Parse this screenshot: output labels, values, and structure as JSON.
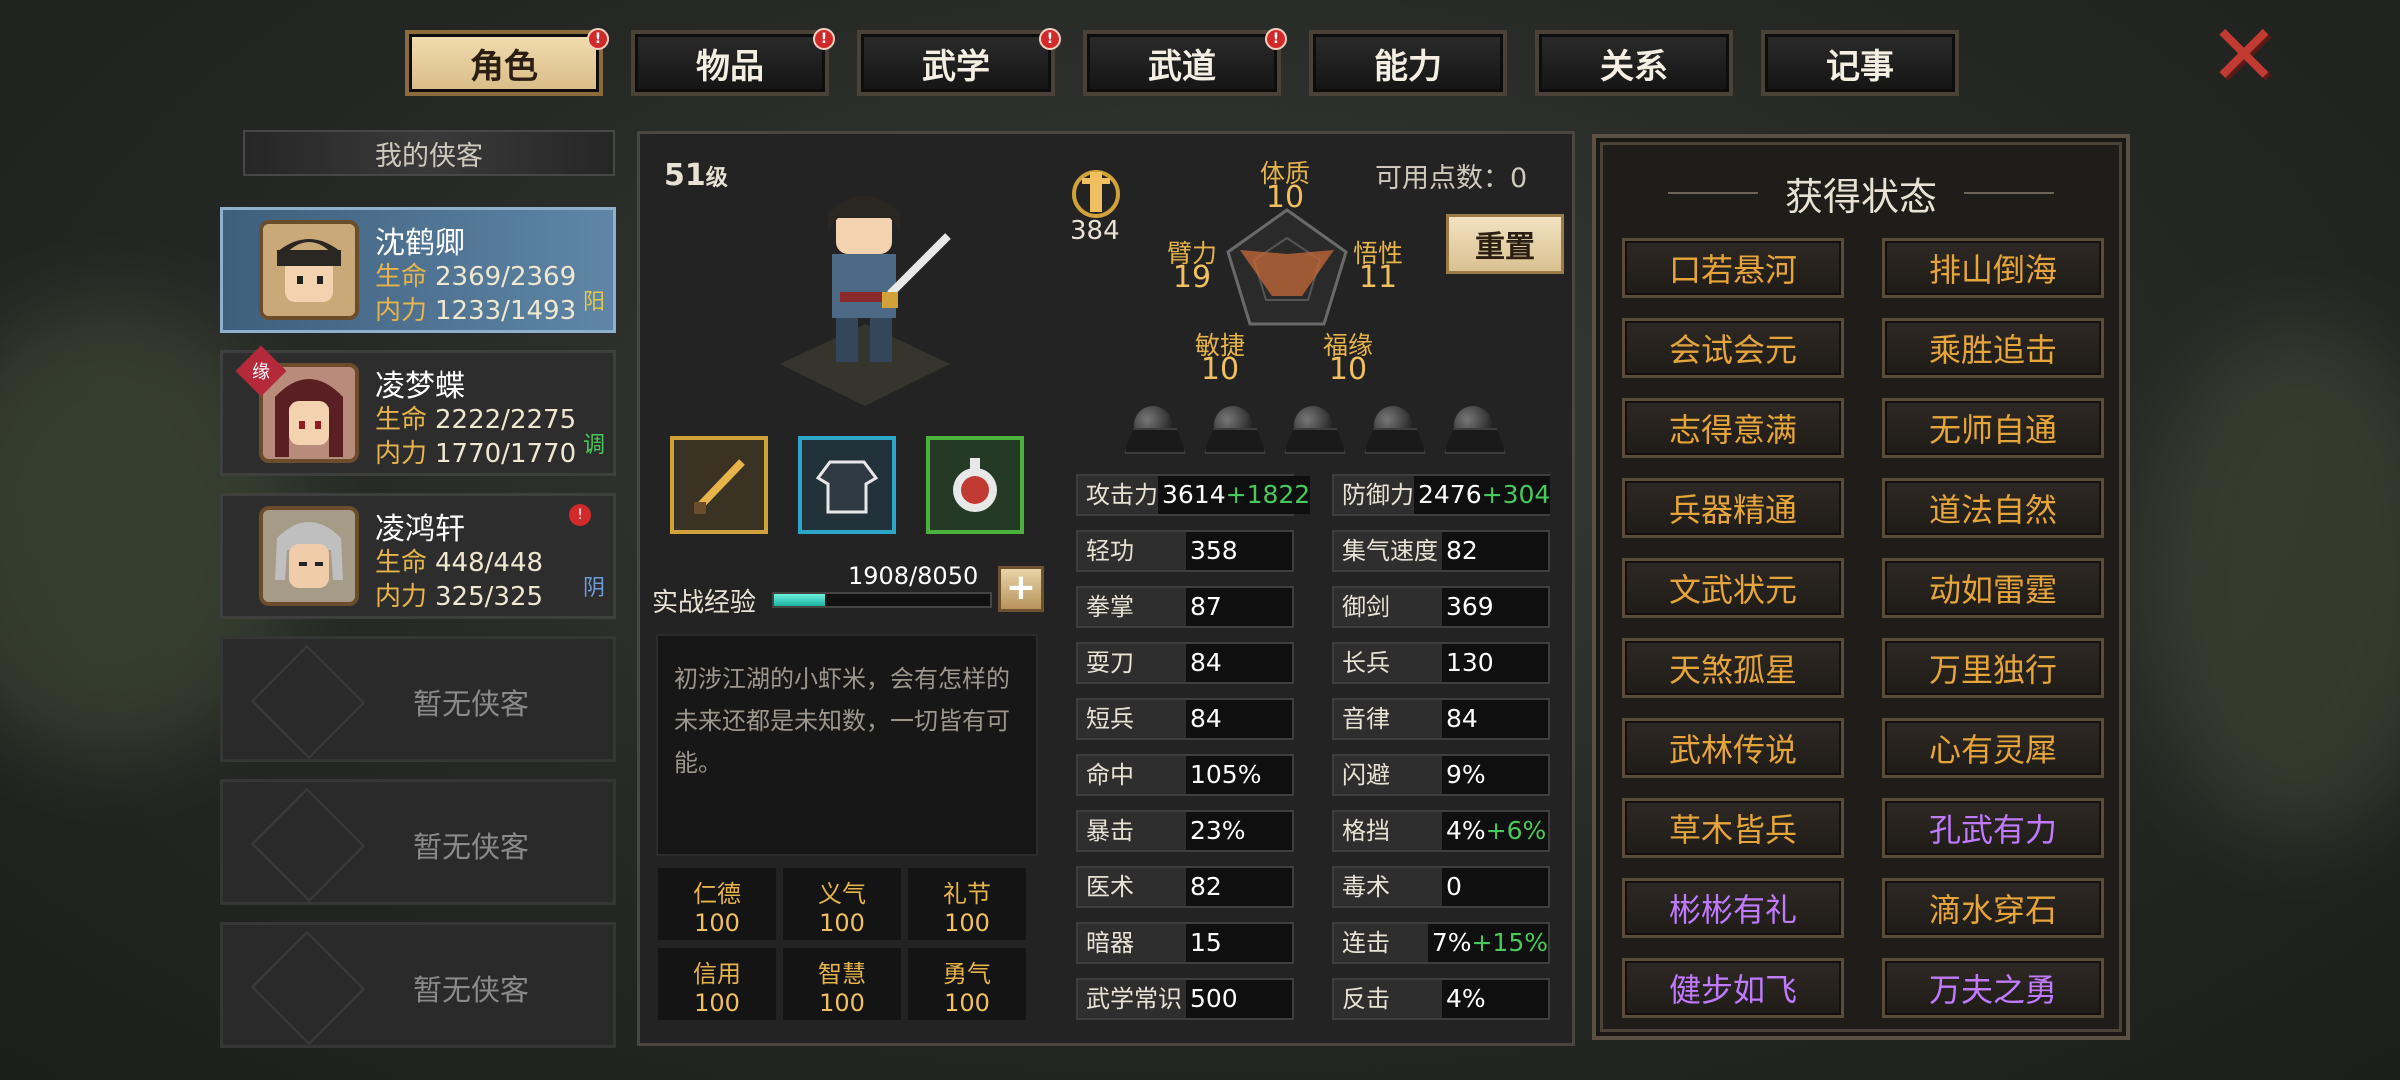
{
  "tabs": [
    {
      "label": "角色",
      "alert": true
    },
    {
      "label": "物品",
      "alert": true
    },
    {
      "label": "武学",
      "alert": true
    },
    {
      "label": "武道",
      "alert": true
    },
    {
      "label": "能力",
      "alert": false
    },
    {
      "label": "关系",
      "alert": false
    },
    {
      "label": "记事",
      "alert": false
    }
  ],
  "close_icon": "close-x-icon",
  "roster": {
    "title": "我的侠客",
    "heroes": [
      {
        "name": "沈鹤卿",
        "hp_label": "生命",
        "hp": "2369/2369",
        "mp_label": "内力",
        "mp": "1233/1493",
        "tag": "阳",
        "tag_color": "#e6c84a"
      },
      {
        "name": "凌梦蝶",
        "hp_label": "生命",
        "hp": "2222/2275",
        "mp_label": "内力",
        "mp": "1770/1770",
        "tag": "调",
        "tag_color": "#49c95a",
        "badge": "缘"
      },
      {
        "name": "凌鸿轩",
        "hp_label": "生命",
        "hp": "448/448",
        "mp_label": "内力",
        "mp": "325/325",
        "tag": "阴",
        "tag_color": "#6f9bd8"
      }
    ],
    "empty_label": "暂无侠客"
  },
  "character": {
    "level": "51",
    "level_unit": "级",
    "power": "384",
    "points_text": "可用点数：0",
    "reset_label": "重置",
    "attrs": {
      "tizhi": {
        "label": "体质",
        "value": "10"
      },
      "bili": {
        "label": "臂力",
        "value": "19"
      },
      "wuxing": {
        "label": "悟性",
        "value": "11"
      },
      "minjie": {
        "label": "敏捷",
        "value": "10"
      },
      "fuyuan": {
        "label": "福缘",
        "value": "10"
      }
    },
    "exp_label": "实战经验",
    "exp_text": "1908/8050",
    "exp_fraction": 0.237,
    "description": "初涉江湖的小虾米，会有怎样的未来还都是未知数，一切皆有可能。",
    "virtues": [
      {
        "label": "仁德",
        "value": "100"
      },
      {
        "label": "义气",
        "value": "100"
      },
      {
        "label": "礼节",
        "value": "100"
      },
      {
        "label": "信用",
        "value": "100"
      },
      {
        "label": "智慧",
        "value": "100"
      },
      {
        "label": "勇气",
        "value": "100"
      }
    ],
    "stats": [
      {
        "name": "攻击力",
        "value": "3614",
        "bonus": "+1822"
      },
      {
        "name": "防御力",
        "value": "2476",
        "bonus": "+304"
      },
      {
        "name": "轻功",
        "value": "358",
        "bonus": ""
      },
      {
        "name": "集气速度",
        "value": "82",
        "bonus": ""
      },
      {
        "name": "拳掌",
        "value": "87",
        "bonus": ""
      },
      {
        "name": "御剑",
        "value": "369",
        "bonus": ""
      },
      {
        "name": "耍刀",
        "value": "84",
        "bonus": ""
      },
      {
        "name": "长兵",
        "value": "130",
        "bonus": ""
      },
      {
        "name": "短兵",
        "value": "84",
        "bonus": ""
      },
      {
        "name": "音律",
        "value": "84",
        "bonus": ""
      },
      {
        "name": "命中",
        "value": "105%",
        "bonus": ""
      },
      {
        "name": "闪避",
        "value": "9%",
        "bonus": ""
      },
      {
        "name": "暴击",
        "value": "23%",
        "bonus": ""
      },
      {
        "name": "格挡",
        "value": "4%",
        "bonus": "+6%"
      },
      {
        "name": "医术",
        "value": "82",
        "bonus": ""
      },
      {
        "name": "毒术",
        "value": "0",
        "bonus": ""
      },
      {
        "name": "暗器",
        "value": "15",
        "bonus": ""
      },
      {
        "name": "连击",
        "value": "7%",
        "bonus": "+15%"
      },
      {
        "name": "武学常识",
        "value": "500",
        "bonus": ""
      },
      {
        "name": "反击",
        "value": "4%",
        "bonus": ""
      }
    ]
  },
  "buffs_panel": {
    "title": "获得状态",
    "buffs": [
      {
        "label": "口若悬河",
        "color": "orange"
      },
      {
        "label": "排山倒海",
        "color": "orange"
      },
      {
        "label": "会试会元",
        "color": "orange"
      },
      {
        "label": "乘胜追击",
        "color": "orange"
      },
      {
        "label": "志得意满",
        "color": "orange"
      },
      {
        "label": "无师自通",
        "color": "orange"
      },
      {
        "label": "兵器精通",
        "color": "orange"
      },
      {
        "label": "道法自然",
        "color": "orange"
      },
      {
        "label": "文武状元",
        "color": "orange"
      },
      {
        "label": "动如雷霆",
        "color": "orange"
      },
      {
        "label": "天煞孤星",
        "color": "orange"
      },
      {
        "label": "万里独行",
        "color": "orange"
      },
      {
        "label": "武林传说",
        "color": "orange"
      },
      {
        "label": "心有灵犀",
        "color": "orange"
      },
      {
        "label": "草木皆兵",
        "color": "orange"
      },
      {
        "label": "孔武有力",
        "color": "purple"
      },
      {
        "label": "彬彬有礼",
        "color": "purple"
      },
      {
        "label": "滴水穿石",
        "color": "orange"
      },
      {
        "label": "健步如飞",
        "color": "purple"
      },
      {
        "label": "万夫之勇",
        "color": "purple"
      }
    ]
  }
}
